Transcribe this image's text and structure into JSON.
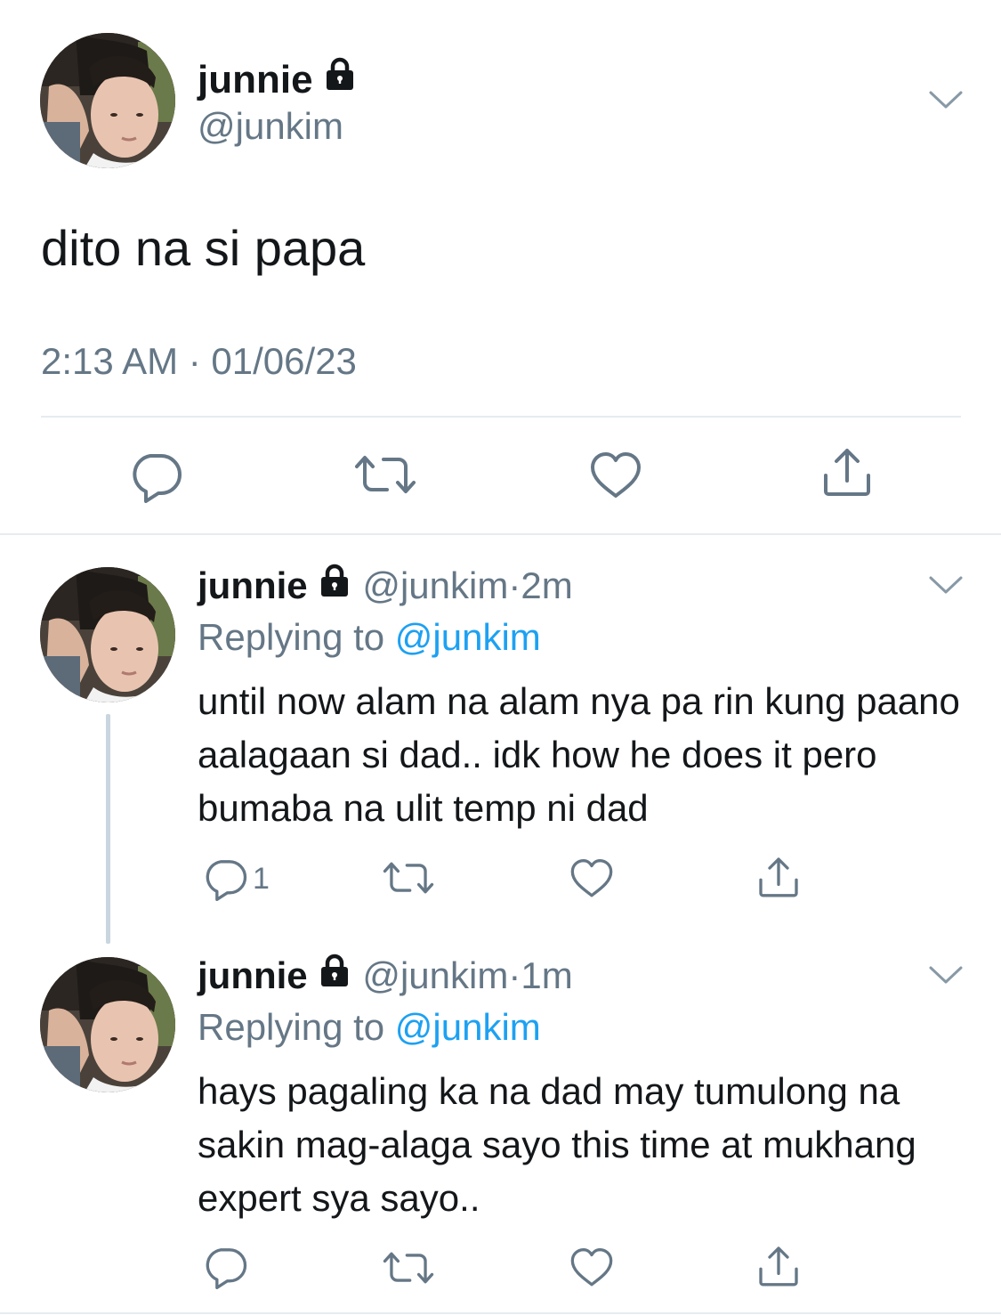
{
  "main_tweet": {
    "display_name": "junnie",
    "handle": "@junkim",
    "text": "dito na si papa",
    "timestamp": "2:13 AM · 01/06/23",
    "actions": [
      "reply-icon",
      "retweet-icon",
      "like-icon",
      "share-icon"
    ]
  },
  "replies": [
    {
      "display_name": "junnie",
      "handle": "@junkim",
      "separator": "·",
      "age": "2m",
      "replying_label": "Replying to",
      "replying_to": "@junkim",
      "text": "until now alam na alam nya pa rin kung paano aalagaan si dad.. idk how he does it pero bumaba na ulit temp ni dad",
      "reply_count": "1"
    },
    {
      "display_name": "junnie",
      "handle": "@junkim",
      "separator": "·",
      "age": "1m",
      "replying_label": "Replying to",
      "replying_to": "@junkim",
      "text": "hays pagaling ka na dad may tumulong na sakin mag-alaga sayo this time at mukhang expert sya sayo..",
      "reply_count": ""
    }
  ],
  "colors": {
    "text": "#14171a",
    "secondary": "#657786",
    "link": "#1da1f2",
    "divider": "#e6ecf0",
    "thread_line": "#c9d6df"
  }
}
